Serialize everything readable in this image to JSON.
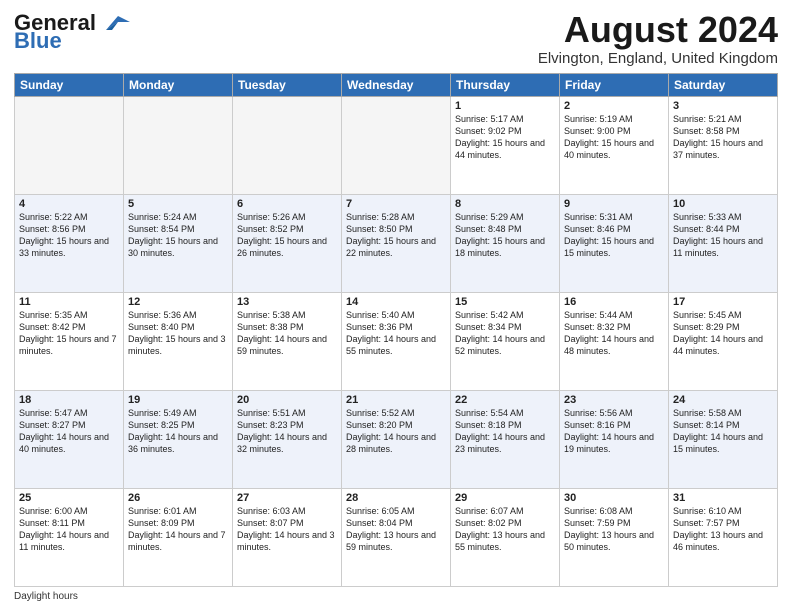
{
  "logo": {
    "general": "General",
    "blue": "Blue"
  },
  "title": "August 2024",
  "subtitle": "Elvington, England, United Kingdom",
  "days_of_week": [
    "Sunday",
    "Monday",
    "Tuesday",
    "Wednesday",
    "Thursday",
    "Friday",
    "Saturday"
  ],
  "weeks": [
    [
      {
        "day": "",
        "empty": true
      },
      {
        "day": "",
        "empty": true
      },
      {
        "day": "",
        "empty": true
      },
      {
        "day": "",
        "empty": true
      },
      {
        "day": "1",
        "sunrise": "5:17 AM",
        "sunset": "9:02 PM",
        "daylight": "15 hours and 44 minutes."
      },
      {
        "day": "2",
        "sunrise": "5:19 AM",
        "sunset": "9:00 PM",
        "daylight": "15 hours and 40 minutes."
      },
      {
        "day": "3",
        "sunrise": "5:21 AM",
        "sunset": "8:58 PM",
        "daylight": "15 hours and 37 minutes."
      }
    ],
    [
      {
        "day": "4",
        "sunrise": "5:22 AM",
        "sunset": "8:56 PM",
        "daylight": "15 hours and 33 minutes."
      },
      {
        "day": "5",
        "sunrise": "5:24 AM",
        "sunset": "8:54 PM",
        "daylight": "15 hours and 30 minutes."
      },
      {
        "day": "6",
        "sunrise": "5:26 AM",
        "sunset": "8:52 PM",
        "daylight": "15 hours and 26 minutes."
      },
      {
        "day": "7",
        "sunrise": "5:28 AM",
        "sunset": "8:50 PM",
        "daylight": "15 hours and 22 minutes."
      },
      {
        "day": "8",
        "sunrise": "5:29 AM",
        "sunset": "8:48 PM",
        "daylight": "15 hours and 18 minutes."
      },
      {
        "day": "9",
        "sunrise": "5:31 AM",
        "sunset": "8:46 PM",
        "daylight": "15 hours and 15 minutes."
      },
      {
        "day": "10",
        "sunrise": "5:33 AM",
        "sunset": "8:44 PM",
        "daylight": "15 hours and 11 minutes."
      }
    ],
    [
      {
        "day": "11",
        "sunrise": "5:35 AM",
        "sunset": "8:42 PM",
        "daylight": "15 hours and 7 minutes."
      },
      {
        "day": "12",
        "sunrise": "5:36 AM",
        "sunset": "8:40 PM",
        "daylight": "15 hours and 3 minutes."
      },
      {
        "day": "13",
        "sunrise": "5:38 AM",
        "sunset": "8:38 PM",
        "daylight": "14 hours and 59 minutes."
      },
      {
        "day": "14",
        "sunrise": "5:40 AM",
        "sunset": "8:36 PM",
        "daylight": "14 hours and 55 minutes."
      },
      {
        "day": "15",
        "sunrise": "5:42 AM",
        "sunset": "8:34 PM",
        "daylight": "14 hours and 52 minutes."
      },
      {
        "day": "16",
        "sunrise": "5:44 AM",
        "sunset": "8:32 PM",
        "daylight": "14 hours and 48 minutes."
      },
      {
        "day": "17",
        "sunrise": "5:45 AM",
        "sunset": "8:29 PM",
        "daylight": "14 hours and 44 minutes."
      }
    ],
    [
      {
        "day": "18",
        "sunrise": "5:47 AM",
        "sunset": "8:27 PM",
        "daylight": "14 hours and 40 minutes."
      },
      {
        "day": "19",
        "sunrise": "5:49 AM",
        "sunset": "8:25 PM",
        "daylight": "14 hours and 36 minutes."
      },
      {
        "day": "20",
        "sunrise": "5:51 AM",
        "sunset": "8:23 PM",
        "daylight": "14 hours and 32 minutes."
      },
      {
        "day": "21",
        "sunrise": "5:52 AM",
        "sunset": "8:20 PM",
        "daylight": "14 hours and 28 minutes."
      },
      {
        "day": "22",
        "sunrise": "5:54 AM",
        "sunset": "8:18 PM",
        "daylight": "14 hours and 23 minutes."
      },
      {
        "day": "23",
        "sunrise": "5:56 AM",
        "sunset": "8:16 PM",
        "daylight": "14 hours and 19 minutes."
      },
      {
        "day": "24",
        "sunrise": "5:58 AM",
        "sunset": "8:14 PM",
        "daylight": "14 hours and 15 minutes."
      }
    ],
    [
      {
        "day": "25",
        "sunrise": "6:00 AM",
        "sunset": "8:11 PM",
        "daylight": "14 hours and 11 minutes."
      },
      {
        "day": "26",
        "sunrise": "6:01 AM",
        "sunset": "8:09 PM",
        "daylight": "14 hours and 7 minutes."
      },
      {
        "day": "27",
        "sunrise": "6:03 AM",
        "sunset": "8:07 PM",
        "daylight": "14 hours and 3 minutes."
      },
      {
        "day": "28",
        "sunrise": "6:05 AM",
        "sunset": "8:04 PM",
        "daylight": "13 hours and 59 minutes."
      },
      {
        "day": "29",
        "sunrise": "6:07 AM",
        "sunset": "8:02 PM",
        "daylight": "13 hours and 55 minutes."
      },
      {
        "day": "30",
        "sunrise": "6:08 AM",
        "sunset": "7:59 PM",
        "daylight": "13 hours and 50 minutes."
      },
      {
        "day": "31",
        "sunrise": "6:10 AM",
        "sunset": "7:57 PM",
        "daylight": "13 hours and 46 minutes."
      }
    ]
  ],
  "footer": {
    "daylight_label": "Daylight hours"
  }
}
